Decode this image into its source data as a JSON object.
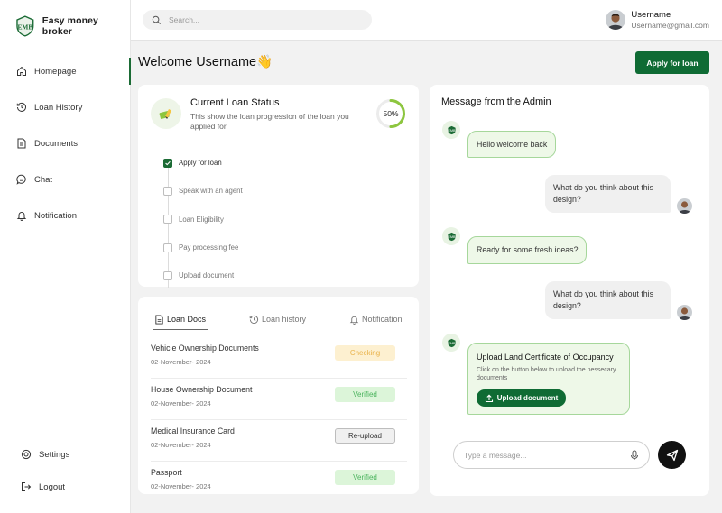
{
  "brand": {
    "name": "Easy money broker",
    "logo_text": "EMB",
    "logo_icon": "shield-logo"
  },
  "colors": {
    "primary": "#0f6b34",
    "accent_green": "#8dc63f",
    "checking": "#e9b24a",
    "verified": "#49b35c"
  },
  "sidebar": {
    "items": [
      {
        "label": "Homepage",
        "icon": "home-icon",
        "active": true
      },
      {
        "label": "Loan History",
        "icon": "history-icon"
      },
      {
        "label": "Documents",
        "icon": "document-icon"
      },
      {
        "label": "Chat",
        "icon": "chat-icon"
      },
      {
        "label": "Notification",
        "icon": "bell-icon"
      }
    ],
    "bottom": [
      {
        "label": "Settings",
        "icon": "gear-icon"
      },
      {
        "label": "Logout",
        "icon": "logout-icon"
      }
    ]
  },
  "header": {
    "search_placeholder": "Search...",
    "user_name": "Username",
    "user_email": "Username@gmail.com"
  },
  "welcome": {
    "text": "Welcome Username👋",
    "apply_label": "Apply for loan"
  },
  "loan_status": {
    "title": "Current Loan Status",
    "description": "This show the loan progression of the loan you applied for",
    "progress_label": "50%",
    "progress": 0.5,
    "steps": [
      {
        "label": "Apply for loan",
        "done": true
      },
      {
        "label": "Speak with an agent",
        "done": false
      },
      {
        "label": "Loan Eligibility",
        "done": false
      },
      {
        "label": "Pay processing fee",
        "done": false
      },
      {
        "label": "Upload document",
        "done": false
      }
    ]
  },
  "docs": {
    "tabs": [
      {
        "label": "Loan Docs",
        "icon": "document-icon",
        "active": true
      },
      {
        "label": "Loan history",
        "icon": "history-icon"
      },
      {
        "label": "Notification",
        "icon": "bell-icon"
      }
    ],
    "rows": [
      {
        "name": "Vehicle Ownership Documents",
        "date": "02-November- 2024",
        "status": "Checking",
        "kind": "checking"
      },
      {
        "name": "House Ownership Document",
        "date": "02-November- 2024",
        "status": "Verified",
        "kind": "verified"
      },
      {
        "name": "Medical Insurance Card",
        "date": "02-November- 2024",
        "status": "Re-upload",
        "kind": "reupload"
      },
      {
        "name": "Passport",
        "date": "02-November- 2024",
        "status": "Verified",
        "kind": "verified"
      }
    ]
  },
  "messages": {
    "title": "Message from the Admin",
    "items": [
      {
        "from": "admin",
        "text": "Hello welcome back"
      },
      {
        "from": "user",
        "text": "What do you think about this design?"
      },
      {
        "from": "admin",
        "text": "Ready for some fresh ideas?"
      },
      {
        "from": "user",
        "text": "What do you think about this design?"
      }
    ],
    "upload": {
      "title": "Upload Land Certificate of Occupancy",
      "description": "Click on the button below to upload the nessecary documents",
      "button_label": "Upload document"
    },
    "input_placeholder": "Type a message..."
  }
}
